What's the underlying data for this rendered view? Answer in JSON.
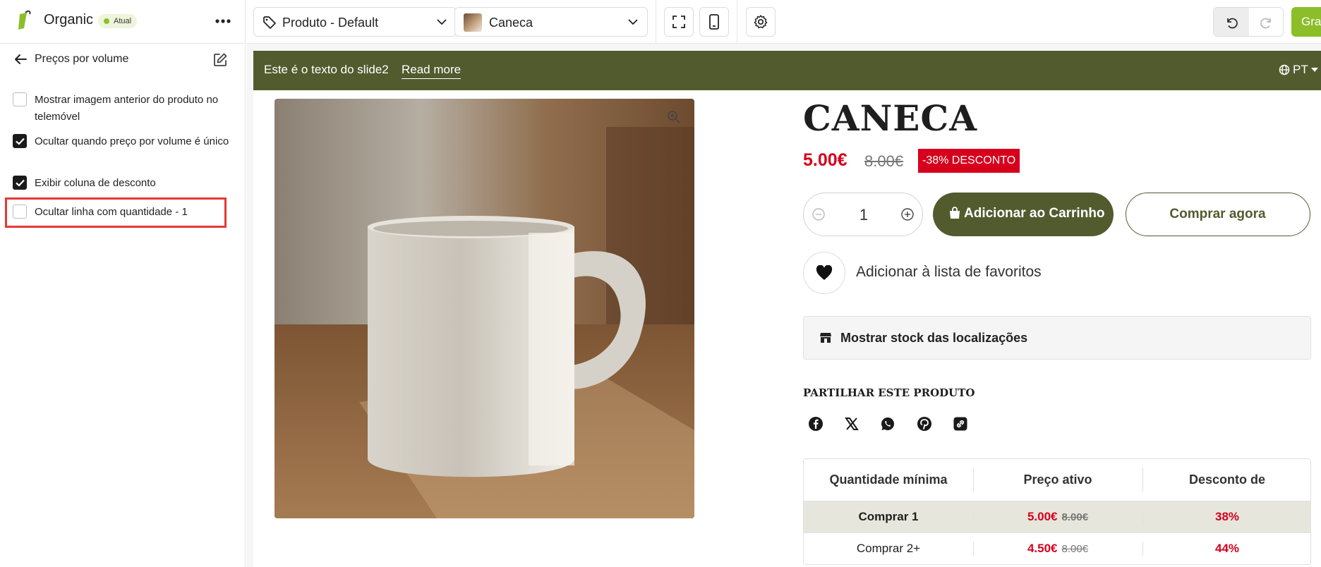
{
  "sidebar": {
    "brand_name": "Organic",
    "badge": "Atual",
    "section_title": "Preços por volume",
    "options": [
      {
        "label": "Mostrar imagem anterior do produto no telemóvel",
        "checked": false
      },
      {
        "label": "Ocultar quando preço por volume é único",
        "checked": true
      },
      {
        "label": "Exibir coluna de desconto",
        "checked": true
      },
      {
        "label": "Ocultar linha com quantidade - 1",
        "checked": false
      }
    ],
    "icons": {
      "logo": "leaf-logo",
      "more": "more-dots-icon",
      "back": "arrow-left-icon",
      "edit": "edit-icon"
    }
  },
  "toolbar": {
    "template_dropdown": "Produto - Default",
    "product_dropdown": "Caneca",
    "save_label": "Gravar",
    "icons": [
      "tag-icon",
      "chevron-down-icon",
      "fullscreen-icon",
      "mobile-icon",
      "gear-icon",
      "undo-icon",
      "redo-icon"
    ]
  },
  "store": {
    "announcement": {
      "text": "Este é o texto do slide2",
      "link": "Read more",
      "language": "PT"
    },
    "product": {
      "title": "CANECA",
      "price": "5.00€",
      "old_price": "8.00€",
      "discount_badge": "-38% DESCONTO",
      "quantity": "1",
      "add_to_cart": "Adicionar ao Carrinho",
      "buy_now": "Comprar agora",
      "wishlist": "Adicionar à lista de favoritos",
      "stock": "Mostrar stock das localizações",
      "share_title": "PARTILHAR ESTE PRODUTO",
      "share_icons": [
        "facebook-icon",
        "x-icon",
        "whatsapp-icon",
        "pinterest-icon",
        "copy-link-icon"
      ]
    },
    "volume_table": {
      "headers": [
        "Quantidade mínima",
        "Preço ativo",
        "Desconto de"
      ],
      "rows": [
        {
          "qty": "Comprar 1",
          "price": "5.00€",
          "old": "8.00€",
          "discount": "38%"
        },
        {
          "qty": "Comprar 2+",
          "price": "4.50€",
          "old": "8.00€",
          "discount": "44%"
        }
      ]
    }
  },
  "colors": {
    "brand_olive": "#525b2e",
    "accent_green": "#8cbe2a",
    "sale_red": "#d6001c",
    "highlight": "#e53935"
  }
}
